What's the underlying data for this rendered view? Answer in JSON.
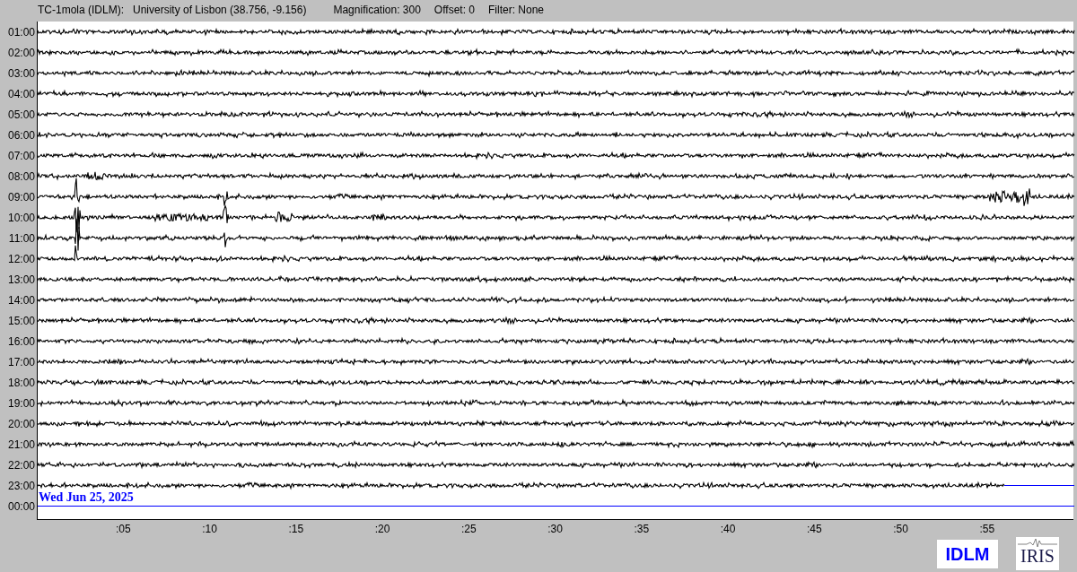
{
  "header": {
    "station": "TC-1mola (IDLM):",
    "location": "University of Lisbon (38.756, -9.156)",
    "magnification": "Magnification: 300",
    "offset": "Offset: 0",
    "filter": "Filter: None"
  },
  "rows": [
    {
      "label": "01:00",
      "kind": "trace"
    },
    {
      "label": "02:00",
      "kind": "trace"
    },
    {
      "label": "03:00",
      "kind": "trace"
    },
    {
      "label": "04:00",
      "kind": "trace"
    },
    {
      "label": "05:00",
      "kind": "trace"
    },
    {
      "label": "06:00",
      "kind": "trace"
    },
    {
      "label": "07:00",
      "kind": "trace"
    },
    {
      "label": "08:00",
      "kind": "trace"
    },
    {
      "label": "09:00",
      "kind": "trace"
    },
    {
      "label": "10:00",
      "kind": "trace"
    },
    {
      "label": "11:00",
      "kind": "trace"
    },
    {
      "label": "12:00",
      "kind": "trace"
    },
    {
      "label": "13:00",
      "kind": "trace"
    },
    {
      "label": "14:00",
      "kind": "trace"
    },
    {
      "label": "15:00",
      "kind": "trace"
    },
    {
      "label": "16:00",
      "kind": "trace"
    },
    {
      "label": "17:00",
      "kind": "trace"
    },
    {
      "label": "18:00",
      "kind": "trace"
    },
    {
      "label": "19:00",
      "kind": "trace"
    },
    {
      "label": "20:00",
      "kind": "trace"
    },
    {
      "label": "21:00",
      "kind": "trace"
    },
    {
      "label": "22:00",
      "kind": "trace"
    },
    {
      "label": "23:00",
      "kind": "partial"
    },
    {
      "label": "00:00",
      "kind": "empty",
      "date": "Wed Jun 25, 2025"
    }
  ],
  "x_ticks": [
    ":05",
    ":10",
    ":15",
    ":20",
    ":25",
    ":30",
    ":35",
    ":40",
    ":45",
    ":50",
    ":55"
  ],
  "logos": {
    "network": "IDLM",
    "iris": "IRIS"
  }
}
